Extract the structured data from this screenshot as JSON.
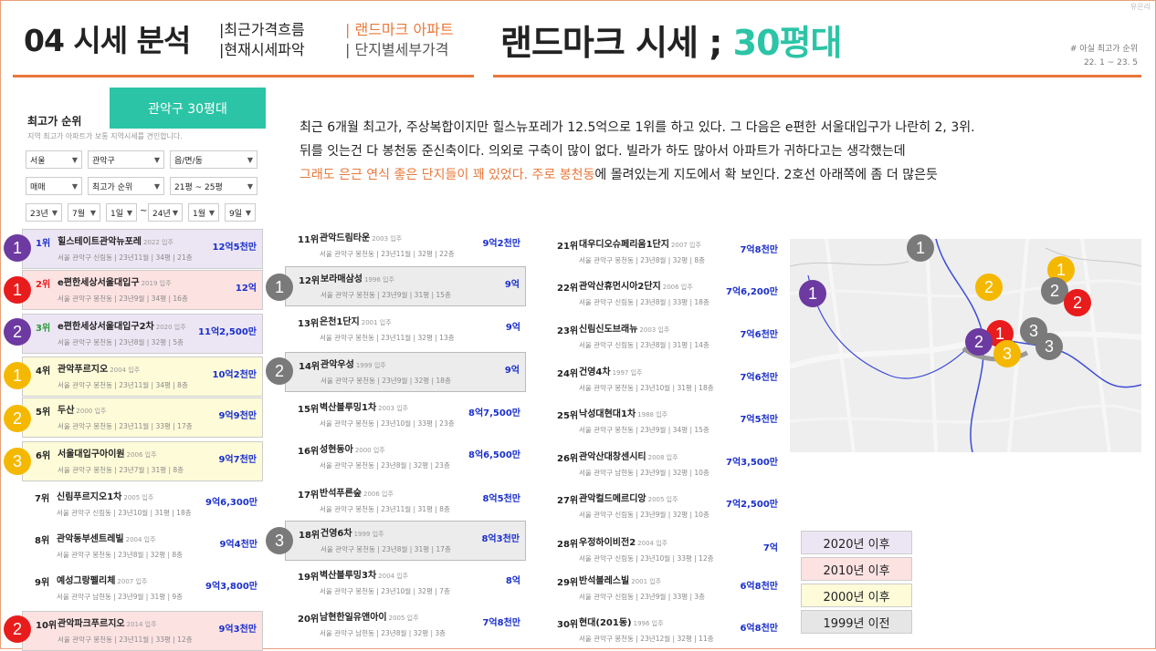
{
  "watermark": "유은리",
  "header": {
    "title": "04 시세 분석",
    "sub1": [
      "|최근가격흐름",
      "|현재시세파악"
    ],
    "sub2a": "| 랜드마크 아파트",
    "sub2b": "| 단지별세부가격",
    "big_title": "랜드마크 시세 ; ",
    "big_accent": "30평대",
    "note1": "# 아실 최고가 순위",
    "note2": "22. 1 ~ 23. 5"
  },
  "description": {
    "line1": "최근 6개월 최고가, 주상복합이지만 힐스뉴포레가 12.5억으로 1위를 하고 있다. 그 다음은 e편한 서울대입구가 나란히 2, 3위.",
    "line2": "뒤를 잇는건 다 봉천동 준신축이다.  의외로 구축이 많이 없다.  빌라가 하도 많아서 아파트가 귀하다고는 생각했는데",
    "line3_orange": "그래도 은근 연식 좋은 단지들이 꽤 있었다.  주로 봉천동",
    "line3_rest": "에 몰려있는게 지도에서 확 보인다.   2호선 아래쪽에 좀 더 많은듯"
  },
  "filter": {
    "title": "최고가 순위",
    "subtitle": "지역 최고가 아파트가 보통 지역시세를 견인합니다.",
    "tab": "관악구 30평대",
    "row1": [
      "서울",
      "관악구",
      "읍/면/동"
    ],
    "row2": [
      "매매",
      "최고가 순위",
      "21평 ~ 25평"
    ],
    "row3": [
      "23년",
      "7월",
      "1일",
      "24년",
      "1월",
      "9일"
    ],
    "tilde": "~"
  },
  "col1": [
    {
      "rank": "1위",
      "name": "힐스테이트관악뉴포레",
      "yr": "2022 입주",
      "sub": "서울 관악구 신림동  |  23년11월  |  34평  |  21층",
      "price": "12억5천만"
    },
    {
      "rank": "2위",
      "name": "e편한세상서울대입구",
      "yr": "2019 입주",
      "sub": "서울 관악구 봉천동  |  23년9월  |  34평  |  16층",
      "price": "12억"
    },
    {
      "rank": "3위",
      "name": "e편한세상서울대입구2차",
      "yr": "2020 입주",
      "sub": "서울 관악구 봉천동  |  23년8월  |  32평  |  5층",
      "price": "11억2,500만"
    },
    {
      "rank": "4위",
      "name": "관악푸르지오",
      "yr": "2004 입주",
      "sub": "서울 관악구 봉천동  |  23년11월  |  34평  |  8층",
      "price": "10억2천만"
    },
    {
      "rank": "5위",
      "name": "두산",
      "yr": "2000 입주",
      "sub": "서울 관악구 봉천동  |  23년11월  |  33평  |  17층",
      "price": "9억9천만"
    },
    {
      "rank": "6위",
      "name": "서울대입구아이원",
      "yr": "2006 입주",
      "sub": "서울 관악구 봉천동  |  23년7월  |  31평  |  8층",
      "price": "9억7천만"
    },
    {
      "rank": "7위",
      "name": "신림푸르지오1차",
      "yr": "2005 입주",
      "sub": "서울 관악구 신림동  |  23년10월  |  31평  |  18층",
      "price": "9억6,300만"
    },
    {
      "rank": "8위",
      "name": "관악동부센트레빌",
      "yr": "2004 입주",
      "sub": "서울 관악구 봉천동  |  23년8월  |  32평  |  8층",
      "price": "9억4천만"
    },
    {
      "rank": "9위",
      "name": "예성그랑펠리체",
      "yr": "2007 입주",
      "sub": "서울 관악구 남현동  |  23년9월  |  31평  |  9층",
      "price": "9억3,800만"
    },
    {
      "rank": "10위",
      "name": "관악파크푸르지오",
      "yr": "2014 입주",
      "sub": "서울 관악구 봉천동  |  23년11월  |  33평  |  12층",
      "price": "9억3천만"
    }
  ],
  "col2": [
    {
      "rank": "11위",
      "name": "관악드림타운",
      "yr": "2003 입주",
      "sub": "서울 관악구 봉천동  |  23년11월  |  32평  |  22층",
      "price": "9억2천만"
    },
    {
      "rank": "12위",
      "name": "보라매삼성",
      "yr": "1996 입주",
      "sub": "서울 관악구 봉천동  |  23년9월  |  31평  |  15층",
      "price": "9억"
    },
    {
      "rank": "13위",
      "name": "은천1단지",
      "yr": "2001 입주",
      "sub": "서울 관악구 봉천동  |  23년11월  |  32평  |  13층",
      "price": "9억"
    },
    {
      "rank": "14위",
      "name": "관악우성",
      "yr": "1999 입주",
      "sub": "서울 관악구 봉천동  |  23년9월  |  32평  |  18층",
      "price": "9억"
    },
    {
      "rank": "15위",
      "name": "벽산블루밍1차",
      "yr": "2003 입주",
      "sub": "서울 관악구 봉천동  |  23년10월  |  33평  |  23층",
      "price": "8억7,500만"
    },
    {
      "rank": "16위",
      "name": "성현동아",
      "yr": "2000 입주",
      "sub": "서울 관악구 봉천동  |  23년8월  |  32평  |  23층",
      "price": "8억6,500만"
    },
    {
      "rank": "17위",
      "name": "반석푸른숲",
      "yr": "2006 입주",
      "sub": "서울 관악구 봉천동  |  23년11월  |  31평  |  8층",
      "price": "8억5천만"
    },
    {
      "rank": "18위",
      "name": "건영6차",
      "yr": "1999 입주",
      "sub": "서울 관악구 봉천동  |  23년8월  |  31평  |  17층",
      "price": "8억3천만"
    },
    {
      "rank": "19위",
      "name": "벽산블루밍3차",
      "yr": "2004 입주",
      "sub": "서울 관악구 봉천동  |  23년10월  |  32평  |  7층",
      "price": "8억"
    },
    {
      "rank": "20위",
      "name": "남현한일유앤아이",
      "yr": "2005 입주",
      "sub": "서울 관악구 남현동  |  23년8월  |  32평  |  3층",
      "price": "7억8천만"
    }
  ],
  "col3": [
    {
      "rank": "21위",
      "name": "대우디오슈페리움1단지",
      "yr": "2007 입주",
      "sub": "서울 관악구 봉천동  |  23년8월  |  32평  |  8층",
      "price": "7억8천만"
    },
    {
      "rank": "22위",
      "name": "관악산휴먼시아2단지",
      "yr": "2006 입주",
      "sub": "서울 관악구 신림동  |  23년8월  |  33평  |  18층",
      "price": "7억6,200만"
    },
    {
      "rank": "23위",
      "name": "신림신도브래뉴",
      "yr": "2003 입주",
      "sub": "서울 관악구 신림동  |  23년8월  |  31평  |  14층",
      "price": "7억6천만"
    },
    {
      "rank": "24위",
      "name": "건영4차",
      "yr": "1997 입주",
      "sub": "서울 관악구 봉천동  |  23년10월  |  31평  |  18층",
      "price": "7억6천만"
    },
    {
      "rank": "25위",
      "name": "낙성대현대1차",
      "yr": "1988 입주",
      "sub": "서울 관악구 봉천동  |  23년9월  |  34평  |  15층",
      "price": "7억5천만"
    },
    {
      "rank": "26위",
      "name": "관악산대창센시티",
      "yr": "2008 입주",
      "sub": "서울 관악구 남현동  |  23년9월  |  32평  |  10층",
      "price": "7억3,500만"
    },
    {
      "rank": "27위",
      "name": "관악컬드메르디앙",
      "yr": "2005 입주",
      "sub": "서울 관악구 신림동  |  23년9월  |  32평  |  10층",
      "price": "7억2,500만"
    },
    {
      "rank": "28위",
      "name": "우정하이비전2",
      "yr": "2004 입주",
      "sub": "서울 관악구 신림동  |  23년10월  |  33평  |  12층",
      "price": "7억"
    },
    {
      "rank": "29위",
      "name": "반석블레스빌",
      "yr": "2001 입주",
      "sub": "서울 관악구 신림동  |  23년9월  |  33평  |  3층",
      "price": "6억8천만"
    },
    {
      "rank": "30위",
      "name": "현대(201동)",
      "yr": "1996 입주",
      "sub": "서울 관악구 봉천동  |  23년12월  |  32평  |  11층",
      "price": "6억8천만"
    }
  ],
  "badges": {
    "one": "1",
    "two": "2",
    "three": "3"
  },
  "legend": [
    "2020년 이후",
    "2010년 이후",
    "2000년 이후",
    "1999년 이전"
  ],
  "colors": {
    "accent": "#2cc4a6",
    "orange": "#e8783a",
    "purple": "#6c3aa0",
    "red": "#e81c1c",
    "yellow": "#f5b800",
    "gray": "#7a7a7a",
    "price": "#1a2fcc"
  }
}
